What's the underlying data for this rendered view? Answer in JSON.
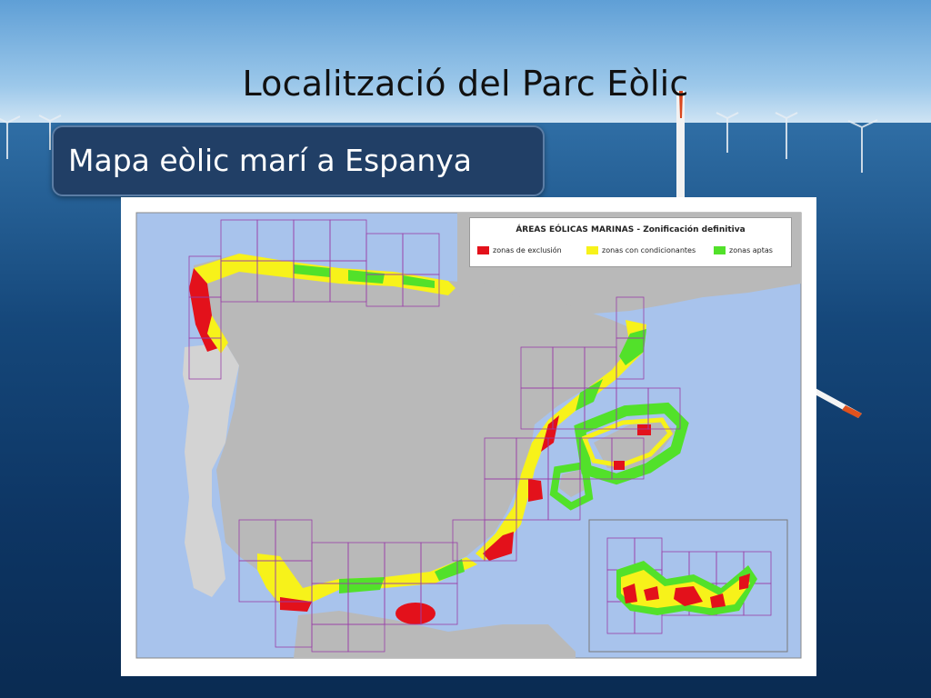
{
  "slide": {
    "title": "Localització del Parc Eòlic",
    "subtitle": "Mapa eòlic marí a Espanya"
  },
  "map": {
    "legend": {
      "title": "ÁREAS EÓLICAS MARINAS - Zonificación definitiva",
      "items": [
        {
          "label": "zonas de exclusión",
          "color": "#e3111b"
        },
        {
          "label": "zonas con condicionantes",
          "color": "#f7f21a"
        },
        {
          "label": "zonas aptas",
          "color": "#52e12a"
        }
      ]
    },
    "colors": {
      "sea": "#a8c3ec",
      "land": "#b9b9b9",
      "portugal": "#d3d3d3",
      "grid": "#9a3fa8"
    }
  }
}
